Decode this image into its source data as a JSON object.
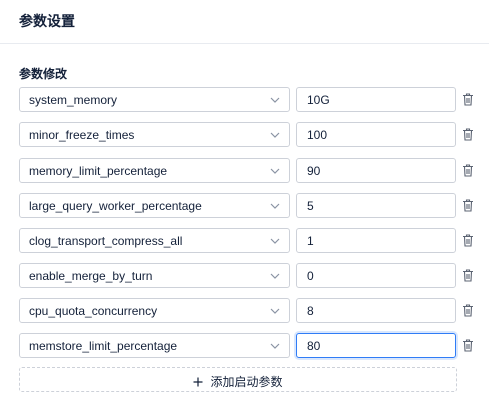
{
  "header": {
    "title": "参数设置"
  },
  "section": {
    "label": "参数修改"
  },
  "params": [
    {
      "name": "system_memory",
      "value": "10G"
    },
    {
      "name": "minor_freeze_times",
      "value": "100"
    },
    {
      "name": "memory_limit_percentage",
      "value": "90"
    },
    {
      "name": "large_query_worker_percentage",
      "value": "5"
    },
    {
      "name": "clog_transport_compress_all",
      "value": "1"
    },
    {
      "name": "enable_merge_by_turn",
      "value": "0"
    },
    {
      "name": "cpu_quota_concurrency",
      "value": "8"
    },
    {
      "name": "memstore_limit_percentage",
      "value": "80"
    }
  ],
  "add_button": {
    "label": "添加启动参数"
  },
  "colors": {
    "accent": "#2f7cf6",
    "border": "#cdd1d9",
    "text": "#132039"
  }
}
